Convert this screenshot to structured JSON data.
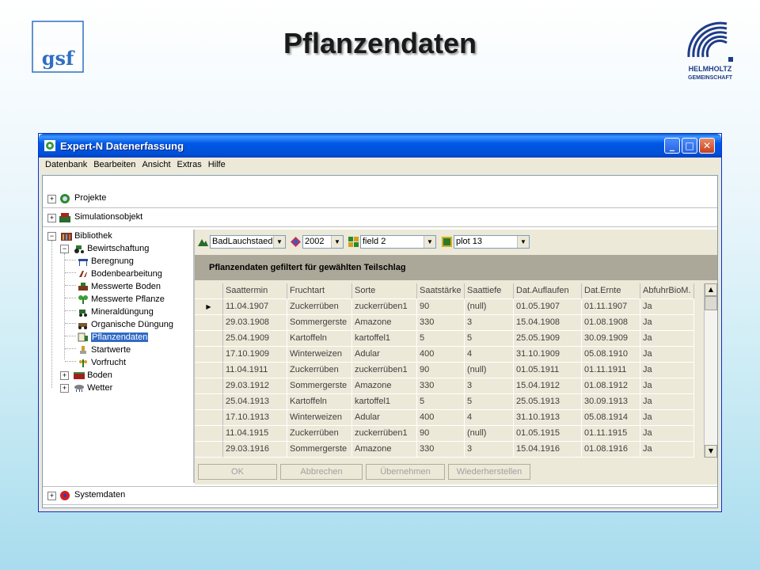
{
  "slide": {
    "title": "Pflanzendaten",
    "logo_left_text": "gsf",
    "logo_right_text_1": "HELMHOLTZ",
    "logo_right_text_2": "GEMEINSCHAFT"
  },
  "window": {
    "title": "Expert-N Datenerfassung",
    "menu": [
      "Datenbank",
      "Bearbeiten",
      "Ansicht",
      "Extras",
      "Hilfe"
    ]
  },
  "groups": {
    "projekte": "Projekte",
    "simulationsobjekt": "Simulationsobjekt",
    "systemdaten": "Systemdaten"
  },
  "tree": {
    "root": "Bibliothek",
    "bewirtschaftung": "Bewirtschaftung",
    "items": [
      "Beregnung",
      "Bodenbearbeitung",
      "Messwerte Boden",
      "Messwerte Pflanze",
      "Mineraldüngung",
      "Organische Düngung",
      "Pflanzendaten",
      "Startwerte",
      "Vorfrucht"
    ],
    "selected": "Pflanzendaten",
    "boden": "Boden",
    "wetter": "Wetter"
  },
  "filters": {
    "site": "BadLauchstaed",
    "year": "2002",
    "field": "field 2",
    "plot": "plot 13"
  },
  "banner": "Pflanzendaten gefiltert für gewählten Teilschlag",
  "grid": {
    "columns": [
      "Saattermin",
      "Fruchtart",
      "Sorte",
      "Saatstärke",
      "Saattiefe",
      "Dat.Auflaufen",
      "Dat.Ernte",
      "AbfuhrBioM."
    ],
    "rows": [
      [
        "11.04.1907",
        "Zuckerrüben",
        "zuckerrüben1",
        "90",
        "(null)",
        "01.05.1907",
        "01.11.1907",
        "Ja"
      ],
      [
        "29.03.1908",
        "Sommergerste",
        "Amazone",
        "330",
        "3",
        "15.04.1908",
        "01.08.1908",
        "Ja"
      ],
      [
        "25.04.1909",
        "Kartoffeln",
        "kartoffel1",
        "5",
        "5",
        "25.05.1909",
        "30.09.1909",
        "Ja"
      ],
      [
        "17.10.1909",
        "Winterweizen",
        "Adular",
        "400",
        "4",
        "31.10.1909",
        "05.08.1910",
        "Ja"
      ],
      [
        "11.04.1911",
        "Zuckerrüben",
        "zuckerrüben1",
        "90",
        "(null)",
        "01.05.1911",
        "01.11.1911",
        "Ja"
      ],
      [
        "29.03.1912",
        "Sommergerste",
        "Amazone",
        "330",
        "3",
        "15.04.1912",
        "01.08.1912",
        "Ja"
      ],
      [
        "25.04.1913",
        "Kartoffeln",
        "kartoffel1",
        "5",
        "5",
        "25.05.1913",
        "30.09.1913",
        "Ja"
      ],
      [
        "17.10.1913",
        "Winterweizen",
        "Adular",
        "400",
        "4",
        "31.10.1913",
        "05.08.1914",
        "Ja"
      ],
      [
        "11.04.1915",
        "Zuckerrüben",
        "zuckerrüben1",
        "90",
        "(null)",
        "01.05.1915",
        "01.11.1915",
        "Ja"
      ],
      [
        "29.03.1916",
        "Sommergerste",
        "Amazone",
        "330",
        "3",
        "15.04.1916",
        "01.08.1916",
        "Ja"
      ]
    ],
    "current_row_marker": "▶"
  },
  "buttons": {
    "ok": "OK",
    "abbrechen": "Abbrechen",
    "uebernehmen": "Übernehmen",
    "wiederherstellen": "Wiederherstellen"
  },
  "colors": {
    "titlebar": "#0058e6",
    "selection": "#316ac5",
    "banner": "#aca899",
    "gsf_logo": "#2e6fc3"
  }
}
